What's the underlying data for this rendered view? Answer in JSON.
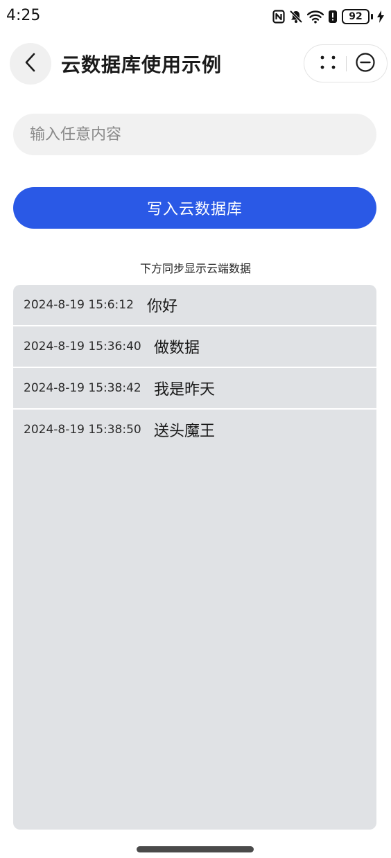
{
  "status_bar": {
    "time": "4:25",
    "battery_level": "92",
    "icons": [
      "nfc-icon",
      "mute-bell-icon",
      "wifi-icon",
      "alert-icon",
      "battery-icon",
      "charging-icon"
    ]
  },
  "header": {
    "title": "云数据库使用示例",
    "back_icon": "chevron-left-icon",
    "more_icon": "more-dots-icon",
    "close_icon": "minus-circle-icon"
  },
  "input": {
    "placeholder": "输入任意内容",
    "value": ""
  },
  "write_button": {
    "label": "写入云数据库",
    "color": "#2a59e6"
  },
  "caption": "下方同步显示云端数据",
  "records": [
    {
      "time": "2024-8-19 15:6:12",
      "content": "你好"
    },
    {
      "time": "2024-8-19 15:36:40",
      "content": "做数据"
    },
    {
      "time": "2024-8-19 15:38:42",
      "content": "我是昨天"
    },
    {
      "time": "2024-8-19 15:38:50",
      "content": "送头魔王"
    }
  ]
}
